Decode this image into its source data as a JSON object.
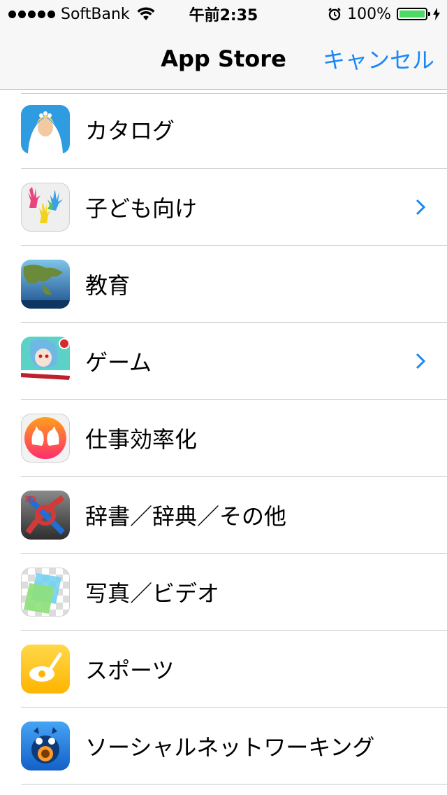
{
  "status_bar": {
    "carrier": "SoftBank",
    "time": "午前2:35",
    "battery_percent": "100%",
    "battery_level": 1.0,
    "signal_bars": 5
  },
  "nav": {
    "title": "App Store",
    "cancel": "キャンセル"
  },
  "categories": [
    {
      "label": "カタログ",
      "icon": "catalog-icon",
      "chevron": false
    },
    {
      "label": "子ども向け",
      "icon": "kids-icon",
      "chevron": true
    },
    {
      "label": "教育",
      "icon": "education-icon",
      "chevron": false
    },
    {
      "label": "ゲーム",
      "icon": "games-icon",
      "chevron": true
    },
    {
      "label": "仕事効率化",
      "icon": "productivity-icon",
      "chevron": false
    },
    {
      "label": "辞書／辞典／その他",
      "icon": "reference-icon",
      "chevron": false
    },
    {
      "label": "写真／ビデオ",
      "icon": "photo-video-icon",
      "chevron": false
    },
    {
      "label": "スポーツ",
      "icon": "sports-icon",
      "chevron": false
    },
    {
      "label": "ソーシャルネットワーキング",
      "icon": "social-networking-icon",
      "chevron": false
    }
  ],
  "colors": {
    "accent": "#1a87f8",
    "battery": "#4cd964",
    "separator": "#c8c7cc"
  }
}
